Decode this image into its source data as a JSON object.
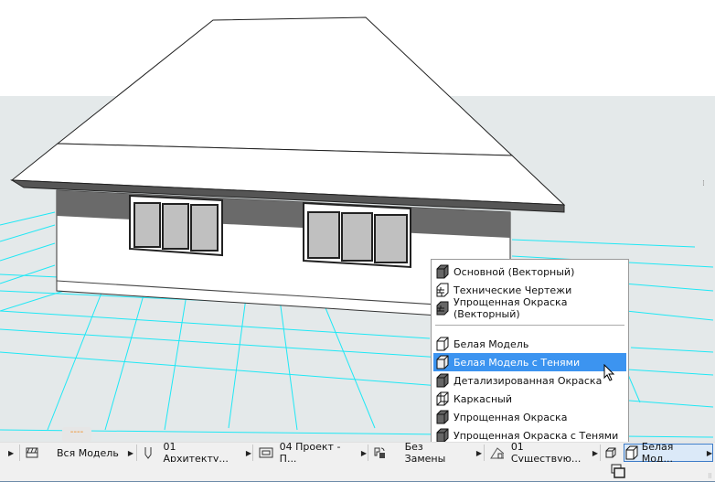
{
  "view_menu": {
    "items": [
      {
        "label": "Основной (Векторный)",
        "icon": "shaded-block-icon"
      },
      {
        "label": "Технические Чертежи",
        "icon": "brick-outline-icon"
      },
      {
        "label": "Упрощенная Окраска (Векторный)",
        "icon": "brick-shaded-icon"
      },
      {
        "label": "Белая Модель",
        "icon": "white-block-icon"
      },
      {
        "label": "Белая Модель с Тенями",
        "icon": "white-block-shadow-icon",
        "selected": true
      },
      {
        "label": "Детализированная Окраска",
        "icon": "shaded-block-icon"
      },
      {
        "label": "Каркасный",
        "icon": "wireframe-icon"
      },
      {
        "label": "Упрощенная Окраска",
        "icon": "shaded-block-icon"
      },
      {
        "label": "Упрощенная Окраска с Тенями",
        "icon": "shaded-block-icon"
      }
    ]
  },
  "statusbar": {
    "model_filter": "Вся Модель",
    "layer_combo": "01 Архитекту...",
    "pen_set": "04 Проект - П...",
    "override": "Без Замены",
    "renovation": "01 Существую...",
    "style_3d": "Белая Мод..."
  },
  "orange_marker": "----",
  "colors": {
    "accent": "#3c94f0",
    "grid": "#00e5f5",
    "background": "#e4e9ea"
  }
}
